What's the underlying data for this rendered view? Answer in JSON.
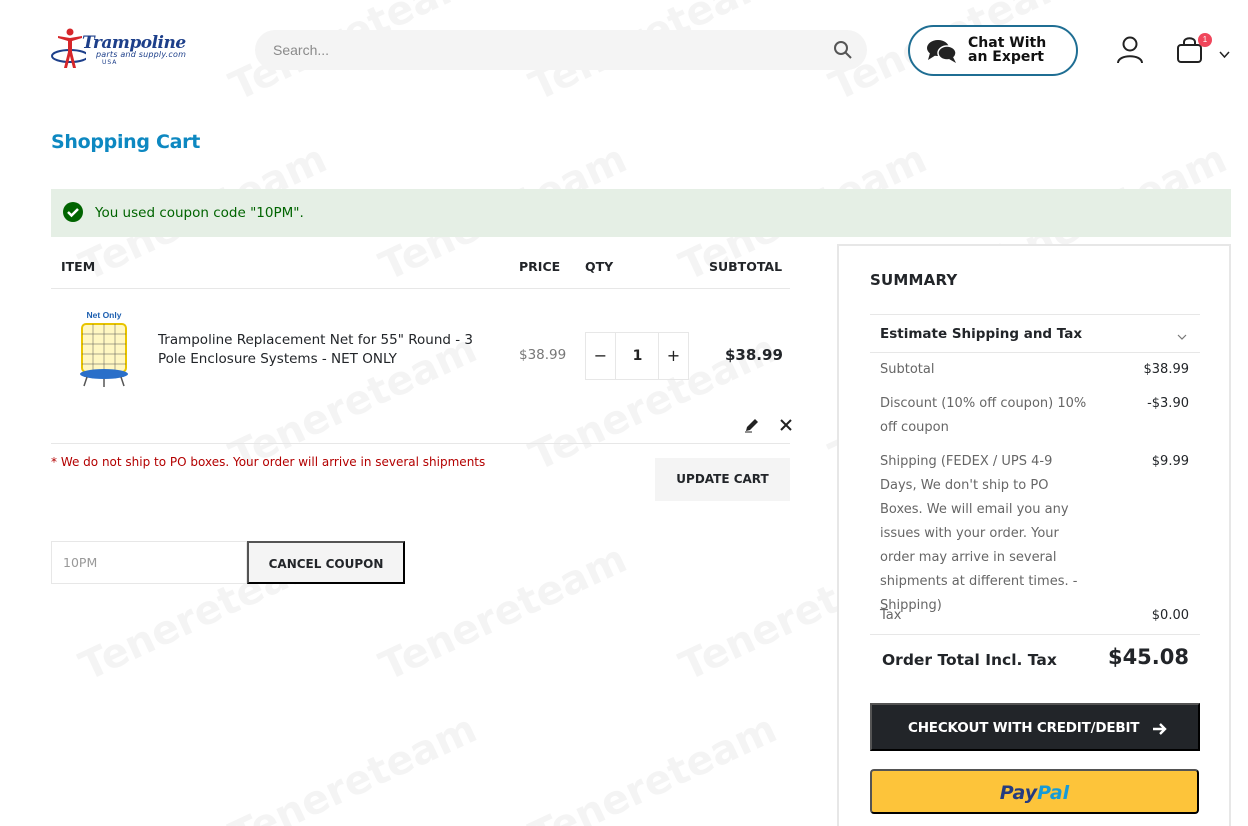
{
  "header": {
    "logo": {
      "brand": "Trampoline",
      "sub": "parts and supply.com",
      "country": "USA"
    },
    "search": {
      "placeholder": "Search..."
    },
    "chat": {
      "label": "Chat With an Expert"
    },
    "cart_count": "1"
  },
  "page_title": "Shopping Cart",
  "message": "You used coupon code \"10PM\".",
  "cart": {
    "columns": {
      "item": "ITEM",
      "price": "PRICE",
      "qty": "QTY",
      "subtotal": "SUBTOTAL"
    },
    "items": [
      {
        "image_label": "Net Only",
        "name": "Trampoline Replacement Net for 55\" Round - 3 Pole Enclosure Systems - NET ONLY",
        "price": "$38.99",
        "qty": "1",
        "subtotal": "$38.99"
      }
    ],
    "notice": "* We do not ship to PO boxes. Your order will arrive in several shipments",
    "update_label": "UPDATE CART",
    "coupon_value": "10PM",
    "cancel_coupon_label": "CANCEL COUPON"
  },
  "summary": {
    "title": "SUMMARY",
    "estimate_label": "Estimate Shipping and Tax",
    "rows": [
      {
        "label": "Subtotal",
        "value": "$38.99"
      },
      {
        "label": "Discount (10% off coupon) 10% off coupon",
        "value": "-$3.90"
      },
      {
        "label": "Shipping (FEDEX / UPS 4-9 Days, We don't ship to PO Boxes. We will email you any issues with your order. Your order may arrive in several shipments at different times. - Shipping)",
        "value": "$9.99"
      },
      {
        "label": "Tax",
        "value": "$0.00"
      }
    ],
    "total_label": "Order Total Incl. Tax",
    "total_value": "$45.08",
    "checkout_label": "CHECKOUT WITH CREDIT/DEBIT",
    "paypal": {
      "part1": "Pay",
      "part2": "Pal"
    }
  },
  "watermark": "Tenereteam",
  "colors": {
    "title_blue": "#0d88c1",
    "success_bg": "#e5efe5",
    "success_text": "#006400",
    "notice_red": "#b30000",
    "checkout_dark": "#222529",
    "paypal_yellow": "#fdc43a",
    "badge_red": "#f0465b"
  }
}
